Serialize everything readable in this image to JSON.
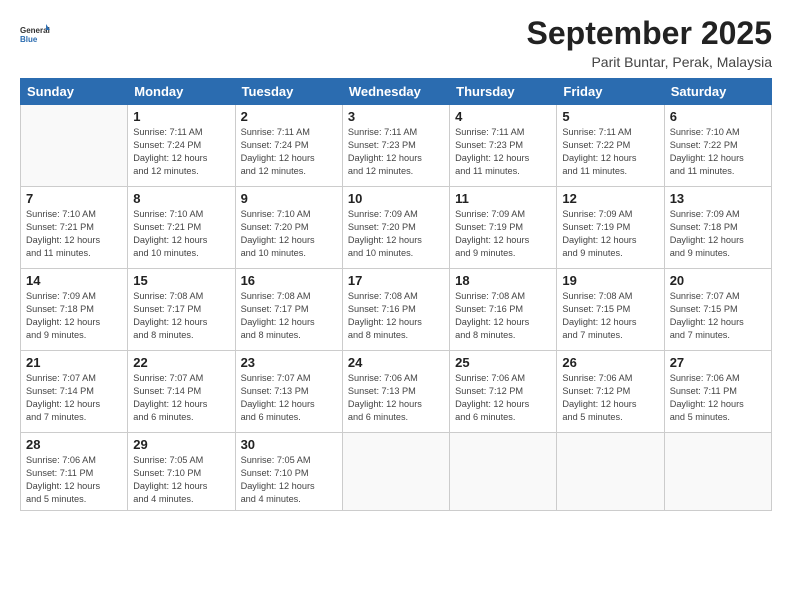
{
  "logo": {
    "general": "General",
    "blue": "Blue"
  },
  "header": {
    "month": "September 2025",
    "location": "Parit Buntar, Perak, Malaysia"
  },
  "days_of_week": [
    "Sunday",
    "Monday",
    "Tuesday",
    "Wednesday",
    "Thursday",
    "Friday",
    "Saturday"
  ],
  "weeks": [
    [
      {
        "day": "",
        "info": ""
      },
      {
        "day": "1",
        "info": "Sunrise: 7:11 AM\nSunset: 7:24 PM\nDaylight: 12 hours\nand 12 minutes."
      },
      {
        "day": "2",
        "info": "Sunrise: 7:11 AM\nSunset: 7:24 PM\nDaylight: 12 hours\nand 12 minutes."
      },
      {
        "day": "3",
        "info": "Sunrise: 7:11 AM\nSunset: 7:23 PM\nDaylight: 12 hours\nand 12 minutes."
      },
      {
        "day": "4",
        "info": "Sunrise: 7:11 AM\nSunset: 7:23 PM\nDaylight: 12 hours\nand 11 minutes."
      },
      {
        "day": "5",
        "info": "Sunrise: 7:11 AM\nSunset: 7:22 PM\nDaylight: 12 hours\nand 11 minutes."
      },
      {
        "day": "6",
        "info": "Sunrise: 7:10 AM\nSunset: 7:22 PM\nDaylight: 12 hours\nand 11 minutes."
      }
    ],
    [
      {
        "day": "7",
        "info": "Sunrise: 7:10 AM\nSunset: 7:21 PM\nDaylight: 12 hours\nand 11 minutes."
      },
      {
        "day": "8",
        "info": "Sunrise: 7:10 AM\nSunset: 7:21 PM\nDaylight: 12 hours\nand 10 minutes."
      },
      {
        "day": "9",
        "info": "Sunrise: 7:10 AM\nSunset: 7:20 PM\nDaylight: 12 hours\nand 10 minutes."
      },
      {
        "day": "10",
        "info": "Sunrise: 7:09 AM\nSunset: 7:20 PM\nDaylight: 12 hours\nand 10 minutes."
      },
      {
        "day": "11",
        "info": "Sunrise: 7:09 AM\nSunset: 7:19 PM\nDaylight: 12 hours\nand 9 minutes."
      },
      {
        "day": "12",
        "info": "Sunrise: 7:09 AM\nSunset: 7:19 PM\nDaylight: 12 hours\nand 9 minutes."
      },
      {
        "day": "13",
        "info": "Sunrise: 7:09 AM\nSunset: 7:18 PM\nDaylight: 12 hours\nand 9 minutes."
      }
    ],
    [
      {
        "day": "14",
        "info": "Sunrise: 7:09 AM\nSunset: 7:18 PM\nDaylight: 12 hours\nand 9 minutes."
      },
      {
        "day": "15",
        "info": "Sunrise: 7:08 AM\nSunset: 7:17 PM\nDaylight: 12 hours\nand 8 minutes."
      },
      {
        "day": "16",
        "info": "Sunrise: 7:08 AM\nSunset: 7:17 PM\nDaylight: 12 hours\nand 8 minutes."
      },
      {
        "day": "17",
        "info": "Sunrise: 7:08 AM\nSunset: 7:16 PM\nDaylight: 12 hours\nand 8 minutes."
      },
      {
        "day": "18",
        "info": "Sunrise: 7:08 AM\nSunset: 7:16 PM\nDaylight: 12 hours\nand 8 minutes."
      },
      {
        "day": "19",
        "info": "Sunrise: 7:08 AM\nSunset: 7:15 PM\nDaylight: 12 hours\nand 7 minutes."
      },
      {
        "day": "20",
        "info": "Sunrise: 7:07 AM\nSunset: 7:15 PM\nDaylight: 12 hours\nand 7 minutes."
      }
    ],
    [
      {
        "day": "21",
        "info": "Sunrise: 7:07 AM\nSunset: 7:14 PM\nDaylight: 12 hours\nand 7 minutes."
      },
      {
        "day": "22",
        "info": "Sunrise: 7:07 AM\nSunset: 7:14 PM\nDaylight: 12 hours\nand 6 minutes."
      },
      {
        "day": "23",
        "info": "Sunrise: 7:07 AM\nSunset: 7:13 PM\nDaylight: 12 hours\nand 6 minutes."
      },
      {
        "day": "24",
        "info": "Sunrise: 7:06 AM\nSunset: 7:13 PM\nDaylight: 12 hours\nand 6 minutes."
      },
      {
        "day": "25",
        "info": "Sunrise: 7:06 AM\nSunset: 7:12 PM\nDaylight: 12 hours\nand 6 minutes."
      },
      {
        "day": "26",
        "info": "Sunrise: 7:06 AM\nSunset: 7:12 PM\nDaylight: 12 hours\nand 5 minutes."
      },
      {
        "day": "27",
        "info": "Sunrise: 7:06 AM\nSunset: 7:11 PM\nDaylight: 12 hours\nand 5 minutes."
      }
    ],
    [
      {
        "day": "28",
        "info": "Sunrise: 7:06 AM\nSunset: 7:11 PM\nDaylight: 12 hours\nand 5 minutes."
      },
      {
        "day": "29",
        "info": "Sunrise: 7:05 AM\nSunset: 7:10 PM\nDaylight: 12 hours\nand 4 minutes."
      },
      {
        "day": "30",
        "info": "Sunrise: 7:05 AM\nSunset: 7:10 PM\nDaylight: 12 hours\nand 4 minutes."
      },
      {
        "day": "",
        "info": ""
      },
      {
        "day": "",
        "info": ""
      },
      {
        "day": "",
        "info": ""
      },
      {
        "day": "",
        "info": ""
      }
    ]
  ]
}
